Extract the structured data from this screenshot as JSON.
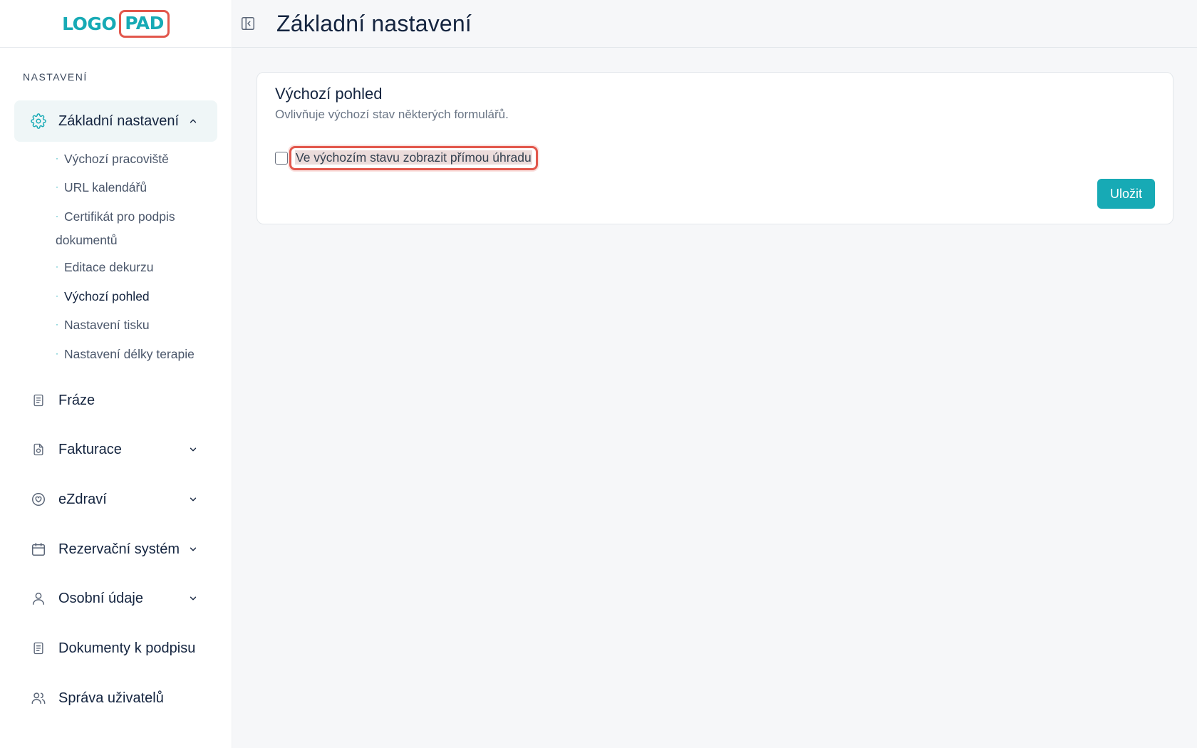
{
  "logo": {
    "part1": "LOGO",
    "part2": "PAD"
  },
  "sidebar": {
    "section_label": "NASTAVENÍ",
    "active_item": {
      "label": "Základní nastavení",
      "icon": "gear-icon",
      "chevron": "chevron-up-icon"
    },
    "sub_items": [
      {
        "label": "Výchozí pracoviště",
        "active": false
      },
      {
        "label": "URL kalendářů",
        "active": false
      },
      {
        "label": "Certifikát pro podpis dokumentů",
        "active": false
      },
      {
        "label": "Editace dekurzu",
        "active": false
      },
      {
        "label": "Výchozí pohled",
        "active": true
      },
      {
        "label": "Nastavení tisku",
        "active": false
      },
      {
        "label": "Nastavení délky terapie",
        "active": false
      }
    ],
    "items": [
      {
        "label": "Fráze",
        "icon": "document-icon",
        "has_chevron": false
      },
      {
        "label": "Fakturace",
        "icon": "invoice-icon",
        "has_chevron": true
      },
      {
        "label": "eZdraví",
        "icon": "heart-circle-icon",
        "has_chevron": true
      },
      {
        "label": "Rezervační systém",
        "icon": "calendar-icon",
        "has_chevron": true
      },
      {
        "label": "Osobní údaje",
        "icon": "user-icon",
        "has_chevron": true
      },
      {
        "label": "Dokumenty k podpisu",
        "icon": "document-icon",
        "has_chevron": false
      },
      {
        "label": "Správa uživatelů",
        "icon": "users-icon",
        "has_chevron": false
      }
    ]
  },
  "header": {
    "title": "Základní nastavení",
    "collapse_icon": "sidebar-collapse-icon"
  },
  "card": {
    "title": "Výchozí pohled",
    "subtitle": "Ovlivňuje výchozí stav některých formulářů.",
    "checkbox_label": "Ve výchozím stavu zobrazit přímou úhradu",
    "checkbox_checked": false,
    "save_label": "Uložit"
  },
  "colors": {
    "accent": "#17aab5",
    "highlight_border": "#e2574c",
    "text_dark": "#14243f"
  }
}
